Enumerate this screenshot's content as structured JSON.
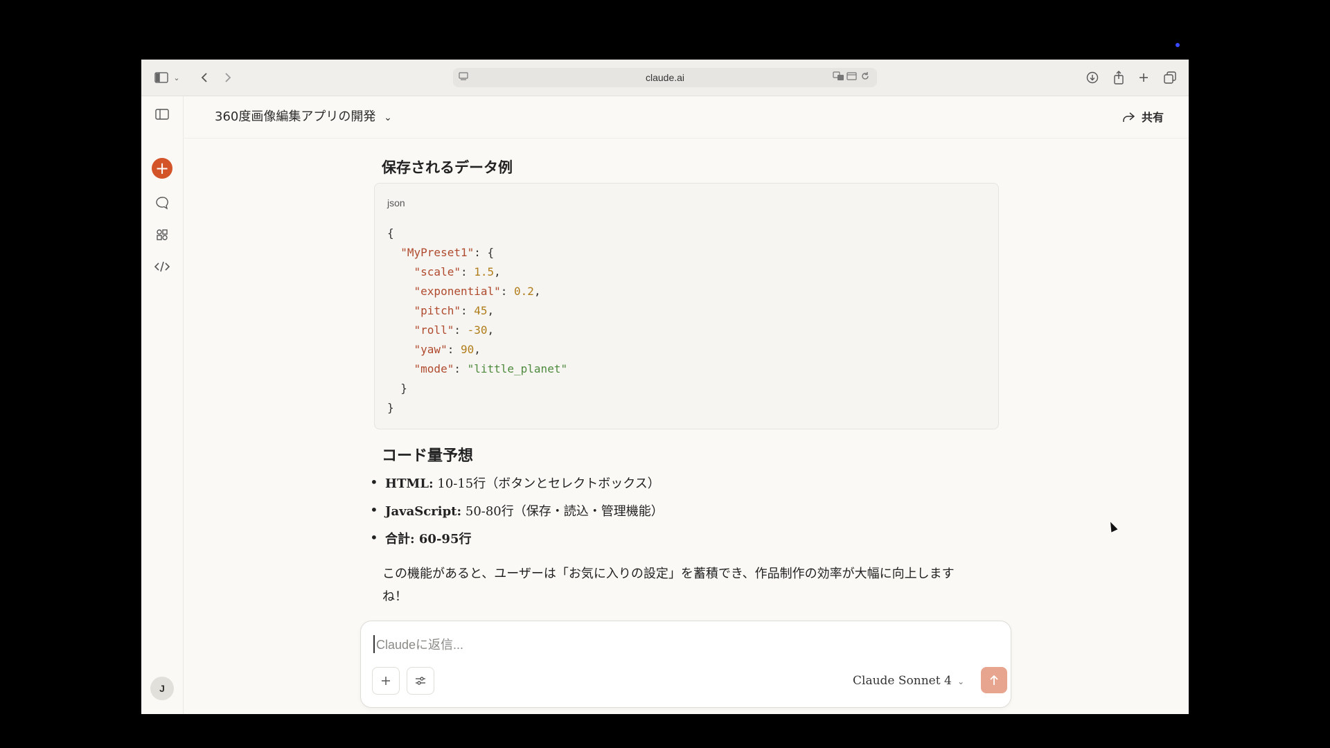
{
  "browser": {
    "url": "claude.ai"
  },
  "header": {
    "title": "360度画像編集アプリの開発",
    "share_label": "共有"
  },
  "content": {
    "heading1": "保存されるデータ例",
    "code_lang": "json",
    "code_lines": [
      "{",
      "  \"MyPreset1\": {",
      "    \"scale\": 1.5,",
      "    \"exponential\": 0.2,",
      "    \"pitch\": 45,",
      "    \"roll\": -30,",
      "    \"yaw\": 90,",
      "    \"mode\": \"little_planet\"",
      "  }",
      "}"
    ],
    "heading2": "コード量予想",
    "bullets": [
      {
        "bold": "HTML:",
        "text": " 10-15行（ボタンとセレクトボックス）"
      },
      {
        "bold": "JavaScript:",
        "text": " 50-80行（保存・読込・管理機能）"
      },
      {
        "bold": "合計: 60-95行",
        "text": ""
      }
    ],
    "paragraph": "この機能があると、ユーザーは「お気に入りの設定」を蓄積でき、作品制作の効率が大幅に向上しますね！"
  },
  "composer": {
    "placeholder": "Claudeに返信...",
    "model_label": "Claude Sonnet 4"
  },
  "sidebar": {
    "avatar_initial": "J"
  },
  "colors": {
    "accent": "#d4542a",
    "send_button": "#e7a58f",
    "background": "#faf9f5"
  },
  "icons": {
    "toolbar": [
      "sidebar-toggle-icon",
      "chevron-down-icon",
      "back-icon",
      "forward-icon",
      "download-icon",
      "share-icon",
      "new-tab-icon",
      "tabs-icon"
    ],
    "sidebar": [
      "sidebar-panel-icon",
      "new-chat-icon",
      "chats-icon",
      "projects-icon",
      "artifacts-code-icon"
    ]
  }
}
